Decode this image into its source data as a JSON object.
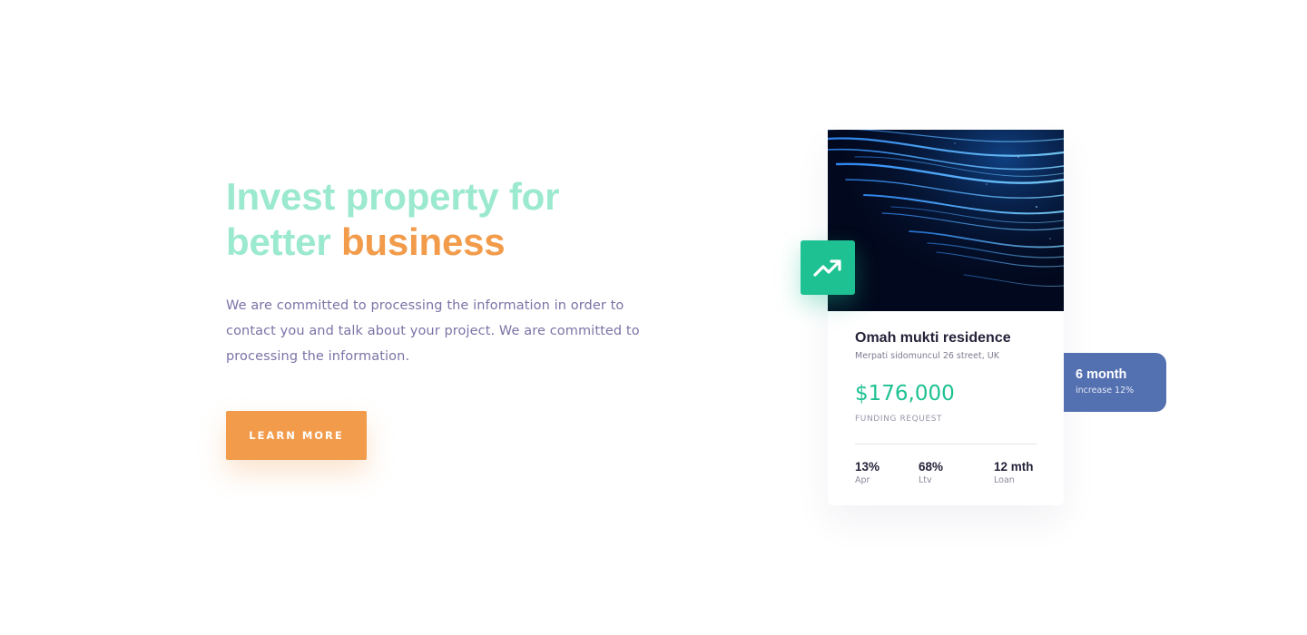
{
  "hero": {
    "title_line1": "Invest property for",
    "title_line2_plain": "better ",
    "title_line2_accent": "business",
    "description": "We are committed to processing the information in order to contact you and talk about your project. We are committed to processing the information.",
    "cta_label": "LEARN MORE"
  },
  "card": {
    "image_icon": "light-streaks-image",
    "badge_icon": "trending-up-icon",
    "name": "Omah mukti residence",
    "address": "Merpati sidomuncul 26 street, UK",
    "price": "$176,000",
    "price_label": "FUNDING REQUEST",
    "stats": [
      {
        "value": "13%",
        "label": "Apr"
      },
      {
        "value": "68%",
        "label": "Ltv"
      },
      {
        "value": "12 mth",
        "label": "Loan"
      }
    ],
    "side_tag": {
      "title": "6 month",
      "subtitle": "increase 12%"
    }
  },
  "colors": {
    "title_mint": "#9be9cf",
    "accent_orange": "#f29b4b",
    "body_text": "#7a74a6",
    "green": "#1ec192",
    "tag_blue": "#5370b0",
    "dark_text": "#25233a"
  }
}
